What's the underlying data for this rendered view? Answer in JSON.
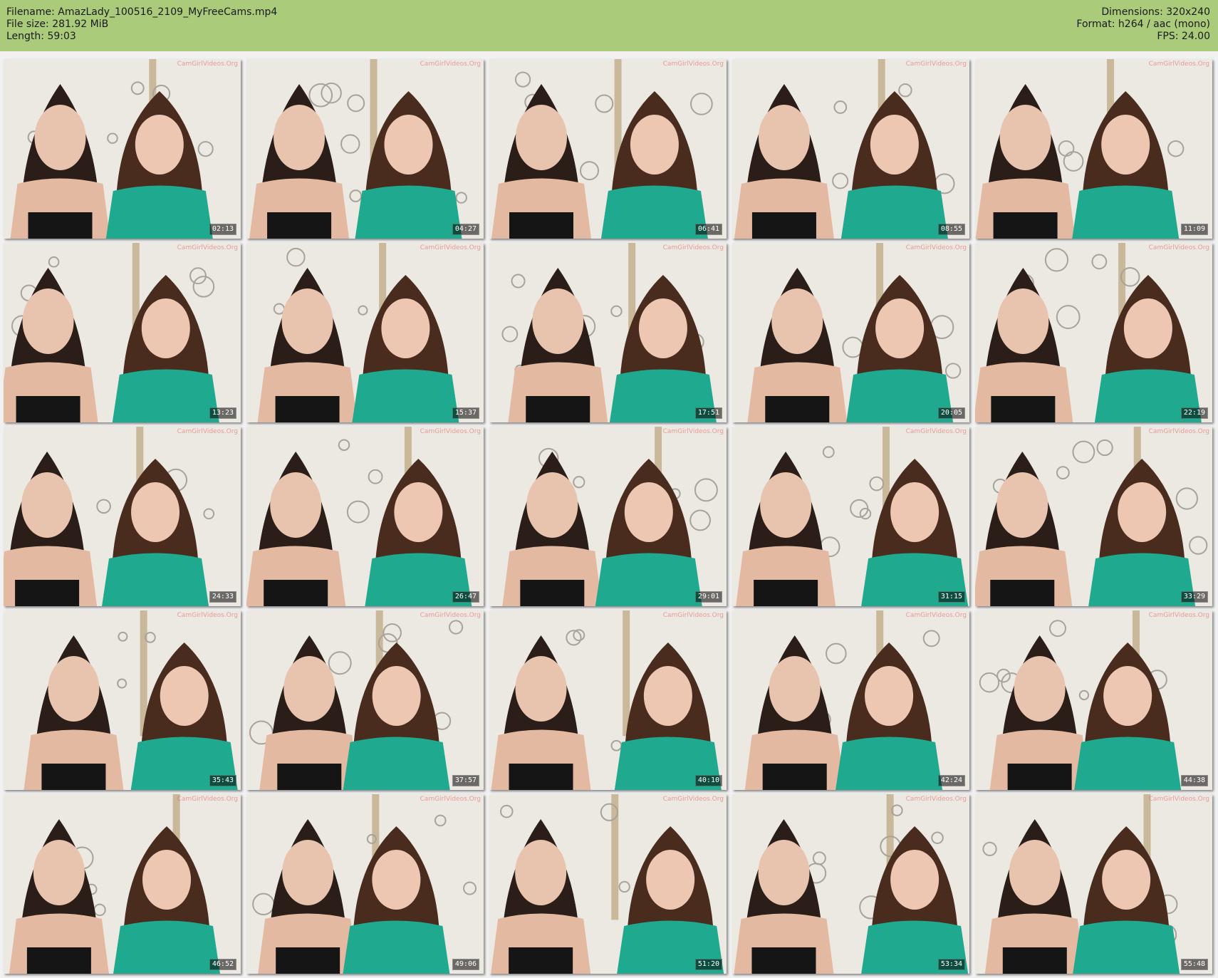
{
  "header": {
    "filename_label": "Filename: AmazLady_100516_2109_MyFreeCams.mp4",
    "filesize_label": "File size: 281.92 MiB",
    "length_label": "Length: 59:03",
    "dimensions_label": "Dimensions: 320x240",
    "format_label": "Format: h264 / aac (mono)",
    "fps_label": "FPS: 24.00",
    "bg_color": "#aacb7a"
  },
  "watermark": "CamGirlVideos.Org",
  "thumbnails": [
    {
      "timestamp": "02:13"
    },
    {
      "timestamp": "04:27"
    },
    {
      "timestamp": "06:41"
    },
    {
      "timestamp": "08:55"
    },
    {
      "timestamp": "11:09"
    },
    {
      "timestamp": "13:23"
    },
    {
      "timestamp": "15:37"
    },
    {
      "timestamp": "17:51"
    },
    {
      "timestamp": "20:05"
    },
    {
      "timestamp": "22:19"
    },
    {
      "timestamp": "24:33"
    },
    {
      "timestamp": "26:47"
    },
    {
      "timestamp": "29:01"
    },
    {
      "timestamp": "31:15"
    },
    {
      "timestamp": "33:29"
    },
    {
      "timestamp": "35:43"
    },
    {
      "timestamp": "37:57"
    },
    {
      "timestamp": "40:10"
    },
    {
      "timestamp": "42:24"
    },
    {
      "timestamp": "44:38"
    },
    {
      "timestamp": "46:52"
    },
    {
      "timestamp": "49:06"
    },
    {
      "timestamp": "51:20"
    },
    {
      "timestamp": "53:34"
    },
    {
      "timestamp": "55:48"
    }
  ]
}
